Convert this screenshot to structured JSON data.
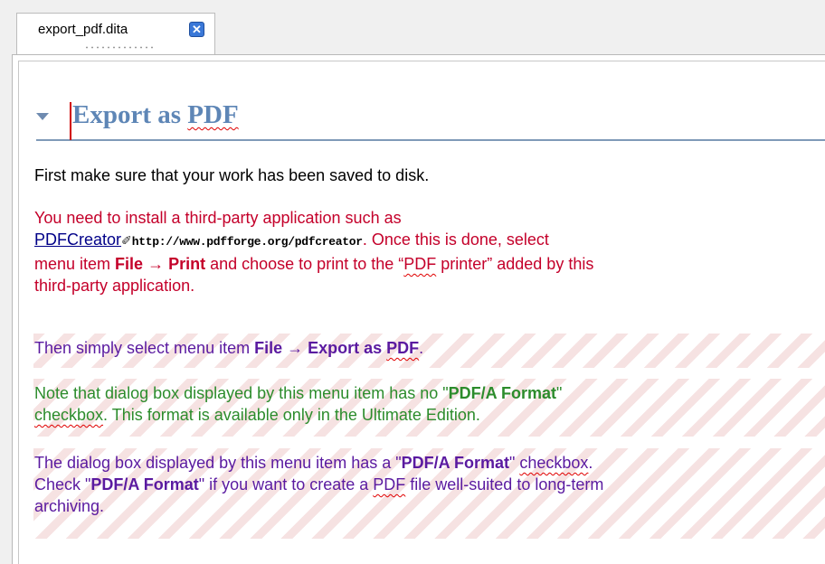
{
  "tab": {
    "title": "export_pdf.dita",
    "close_glyph": "✕"
  },
  "heading": {
    "prefix": "Export as ",
    "pdf": "PDF"
  },
  "p1": {
    "text": "First make sure that your work has been saved to disk."
  },
  "p2": {
    "t1": "You need to install a third-party application such as",
    "link": "PDFCreator",
    "link_icon": "✐",
    "url": "http://www.pdfforge.org/pdfcreator",
    "t2": ". Once this is done, select",
    "t3": "menu item ",
    "file": "File",
    "arrow": " → ",
    "print": "Print",
    "t4": " and choose to print to the “",
    "pdf": "PDF",
    "t5": " printer” added by this",
    "t6": "third-party application."
  },
  "p3": {
    "t1": "Then simply select menu item ",
    "file": "File",
    "arrow": " → ",
    "export": "Export as ",
    "pdf": "PDF",
    "t2": "."
  },
  "p4": {
    "t1": "Note that dialog box displayed by this menu item has no \"",
    "fmt": "PDF/A Format",
    "t2": "\"",
    "checkbox": "checkbox",
    "t3": ". This format is available only in the Ultimate Edition."
  },
  "p5": {
    "t1": "The dialog box displayed by this menu item has a \"",
    "fmt": "PDF/A Format",
    "t2": "\" ",
    "checkbox": "checkbox",
    "t3": ".",
    "t4": "Check \"",
    "fmt2": "PDF/A Format",
    "t5": "\" if you want to create a ",
    "pdf": "PDF",
    "t6": " file well-suited to long-term",
    "t7": "archiving."
  },
  "colors": {
    "heading": "#5e86b6",
    "p2": "#c4002a",
    "p3": "#5a1aa0",
    "p4": "#2c8c2c",
    "p5": "#5a1aa0",
    "spell_underline": "#e00000"
  }
}
